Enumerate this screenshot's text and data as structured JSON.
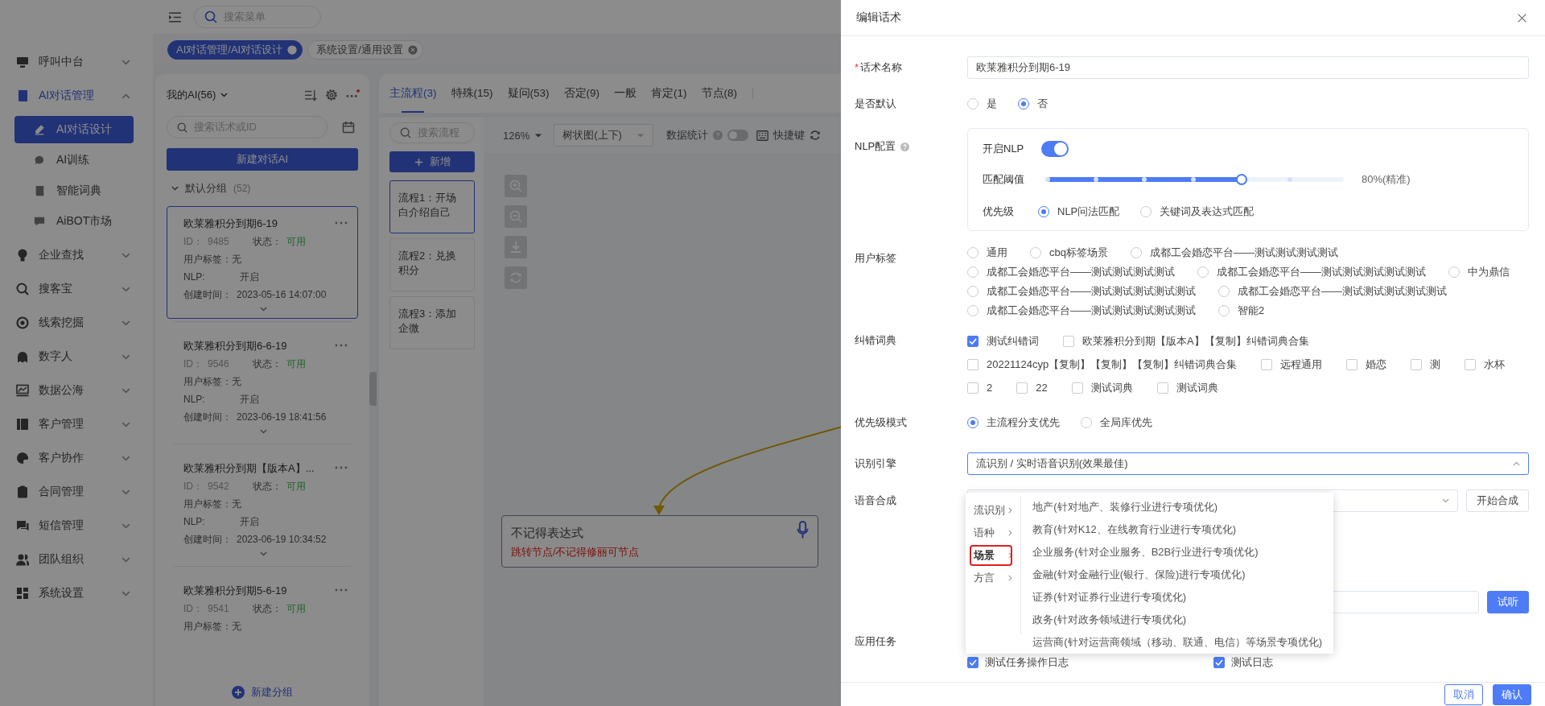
{
  "sidebar": {
    "items": [
      {
        "label": "呼叫中台",
        "expanded": false
      },
      {
        "label": "AI对话管理",
        "expanded": true,
        "children": [
          {
            "label": "AI对话设计",
            "selected": true
          },
          {
            "label": "AI训练",
            "selected": false
          },
          {
            "label": "智能词典",
            "selected": false
          },
          {
            "label": "AiBOT市场",
            "selected": false
          }
        ]
      },
      {
        "label": "企业查找",
        "expanded": false
      },
      {
        "label": "搜客宝",
        "expanded": false
      },
      {
        "label": "线索挖掘",
        "expanded": false
      },
      {
        "label": "数字人",
        "expanded": false
      },
      {
        "label": "数据公海",
        "expanded": false
      },
      {
        "label": "客户管理",
        "expanded": false
      },
      {
        "label": "客户协作",
        "expanded": false
      },
      {
        "label": "合同管理",
        "expanded": false
      },
      {
        "label": "短信管理",
        "expanded": false
      },
      {
        "label": "团队组织",
        "expanded": false
      },
      {
        "label": "系统设置",
        "expanded": false
      }
    ]
  },
  "menu_search": {
    "placeholder": "搜索菜单"
  },
  "open_tabs": [
    {
      "label": "AI对话管理/AI对话设计",
      "selected": true
    },
    {
      "label": "系统设置/通用设置",
      "selected": false
    }
  ],
  "ai_list": {
    "title": "我的AI(56)",
    "search": {
      "placeholder": "搜索话术或ID"
    },
    "new_button": "新建对话AI",
    "group": {
      "label": "默认分组",
      "count": "(52)",
      "expanded": true
    },
    "cards": [
      {
        "title": "欧莱雅积分到期6-19",
        "id_label": "ID：",
        "id": "9485",
        "status_label": "状态：",
        "status": "可用",
        "tag": "用户标签：无",
        "nlp_label": "NLP:",
        "nlp": "开启",
        "created_label": "创建时间：",
        "created": "2023-05-16 14:07:00",
        "selected": true
      },
      {
        "title": "欧莱雅积分到期6-6-19",
        "id_label": "ID：",
        "id": "9546",
        "status_label": "状态：",
        "status": "可用",
        "tag": "用户标签：无",
        "nlp_label": "NLP:",
        "nlp": "开启",
        "created_label": "创建时间：",
        "created": "2023-06-19 18:41:56",
        "selected": false
      },
      {
        "title": "欧莱雅积分到期【版本A】...",
        "id_label": "ID：",
        "id": "9542",
        "status_label": "状态：",
        "status": "可用",
        "tag": "用户标签：无",
        "nlp_label": "NLP:",
        "nlp": "开启",
        "created_label": "创建时间：",
        "created": "2023-06-19 10:34:52",
        "selected": false
      },
      {
        "title": "欧莱雅积分到期5-6-19",
        "id_label": "ID：",
        "id": "9541",
        "status_label": "状态：",
        "status": "可用",
        "tag": "用户标签：无",
        "selected": false
      }
    ],
    "new_group_button": "新建分组"
  },
  "main": {
    "tabs": [
      {
        "label": "主流程(3)",
        "selected": true
      },
      {
        "label": "特殊(15)",
        "selected": false
      },
      {
        "label": "疑问(53)",
        "selected": false
      },
      {
        "label": "否定(9)",
        "selected": false
      },
      {
        "label": "一般",
        "selected": false
      },
      {
        "label": "肯定(1)",
        "selected": false
      },
      {
        "label": "节点(8)",
        "selected": false
      }
    ],
    "flow_search": {
      "placeholder": "搜索流程"
    },
    "add_button": "新增",
    "flows": [
      {
        "label": "流程1：开场白介绍自己",
        "selected": true
      },
      {
        "label": "流程2：兑换积分",
        "selected": false
      },
      {
        "label": "流程3：添加企微",
        "selected": false
      }
    ],
    "toolbar": {
      "zoom": "126%",
      "layout": "树状图(上下)",
      "stats_label": "数据统计",
      "stats_on": false,
      "shortcuts": "快捷键"
    },
    "node": {
      "title": "不记得表达式",
      "subtitle": "跳转节点/不记得修丽可节点"
    }
  },
  "drawer": {
    "title": "编辑话术",
    "name": {
      "required_mark": "*",
      "label": "话术名称",
      "value": "欧莱雅积分到期6-19"
    },
    "default": {
      "label": "是否默认",
      "options": [
        {
          "label": "是",
          "selected": false
        },
        {
          "label": "否",
          "selected": true
        }
      ]
    },
    "nlp": {
      "label": "NLP配置",
      "enable_label": "开启NLP",
      "on": true,
      "threshold_label": "匹配阈值",
      "level": 0.667,
      "reading": "80%(精准)",
      "priority_label": "优先级",
      "priority_options": [
        {
          "label": "NLP问法匹配",
          "selected": true
        },
        {
          "label": "关键词及表达式匹配",
          "selected": false
        }
      ]
    },
    "user_tags": {
      "label": "用户标签",
      "options": [
        {
          "label": "通用",
          "selected": false
        },
        {
          "label": "cbq标签场景",
          "selected": false
        },
        {
          "label": "成都工会婚恋平台——测试测试测试测试",
          "selected": false
        },
        {
          "label": "成都工会婚恋平台——测试测试测试测试",
          "selected": false
        },
        {
          "label": "成都工会婚恋平台——测试测试测试测试测试",
          "selected": false
        },
        {
          "label": "中为鼎信",
          "selected": false
        },
        {
          "label": "成都工会婚恋平台——测试测试测试测试测试",
          "selected": false
        },
        {
          "label": "成都工会婚恋平台——测试测试测试测试测试",
          "selected": false
        },
        {
          "label": "成都工会婚恋平台——测试测试测试测试测试",
          "selected": false
        },
        {
          "label": "智能2",
          "selected": false
        }
      ]
    },
    "dictionary": {
      "label": "纠错词典",
      "rows": [
        [
          {
            "label": "测试纠错词",
            "checked": true
          },
          {
            "label": "欧莱雅积分到期【版本A】【复制】纠错词典合集",
            "checked": false
          }
        ],
        [
          {
            "label": "20221124cyp【复制】【复制】【复制】纠错词典合集",
            "checked": false
          },
          {
            "label": "远程通用",
            "checked": false
          },
          {
            "label": "婚恋",
            "checked": false
          },
          {
            "label": "测",
            "checked": false
          },
          {
            "label": "水杯",
            "checked": false
          }
        ],
        [
          {
            "label": "2",
            "checked": false
          },
          {
            "label": "22",
            "checked": false
          },
          {
            "label": "测试词典",
            "checked": false
          },
          {
            "label": "测试词典",
            "checked": false
          }
        ]
      ]
    },
    "priority_mode": {
      "label": "优先级模式",
      "options": [
        {
          "label": "主流程分支优先",
          "selected": true
        },
        {
          "label": "全局库优先",
          "selected": false
        }
      ]
    },
    "engine": {
      "label": "识别引擎",
      "value": "流识别 / 实时语音识别(效果最佳)",
      "expanded": true
    },
    "tts": {
      "label": "语音合成",
      "button": "开始合成"
    },
    "audition": {
      "button": "试听"
    },
    "tasks": {
      "label": "应用任务",
      "items": [
        {
          "label": "测试任务操作日志",
          "checked": true
        },
        {
          "label": "测试日志",
          "checked": true
        }
      ]
    },
    "footer": {
      "cancel": "取消",
      "confirm": "确认"
    },
    "cascader": {
      "categories": [
        {
          "label": "流识别",
          "selected": false,
          "annotated": false
        },
        {
          "label": "语种",
          "selected": false,
          "annotated": false
        },
        {
          "label": "场景",
          "selected": true,
          "annotated": true
        },
        {
          "label": "方言",
          "selected": false,
          "annotated": false
        }
      ],
      "options": [
        "地产(针对地产、装修行业进行专项优化)",
        "教育(针对K12、在线教育行业进行专项优化)",
        "企业服务(针对企业服务、B2B行业进行专项优化)",
        "金融(针对金融行业(银行、保险)进行专项优化)",
        "证券(针对证券行业进行专项优化)",
        "政务(针对政务领域进行专项优化)",
        "运营商(针对运营商领域（移动、联通、电信）等场景专项优化)"
      ]
    }
  }
}
